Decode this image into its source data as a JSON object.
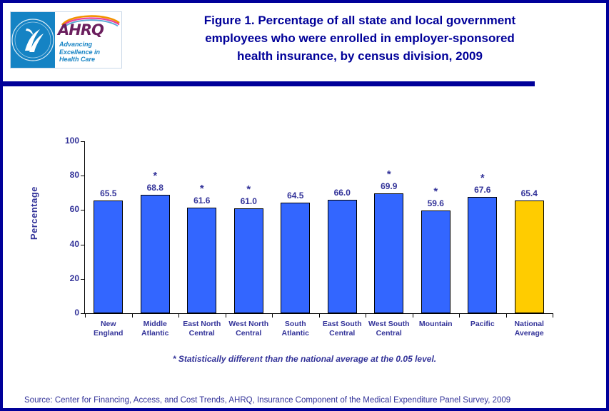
{
  "header": {
    "title": "Figure 1. Percentage of all state and local government employees who were enrolled in employer-sponsored health insurance, by census division, 2009",
    "title_line1": "Figure 1. Percentage of all state and local government",
    "title_line2": "employees who were enrolled in employer-sponsored",
    "title_line3": "health insurance, by census division, 2009",
    "logo": {
      "agency_acronym": "AHRQ",
      "tagline_line1": "Advancing",
      "tagline_line2": "Excellence in",
      "tagline_line3": "Health Care",
      "seal_name": "hhs-seal-icon"
    }
  },
  "footnote": "* Statistically different than the national average at the 0.05 level.",
  "source": "Source: Center for Financing, Access, and Cost Trends, AHRQ, Insurance Component of the Medical Expenditure Panel Survey, 2009",
  "colors": {
    "border": "#000099",
    "title_text": "#000099",
    "chart_text": "#333399",
    "bar_blue": "#3366FF",
    "bar_gold": "#FFCC00",
    "bar_outline": "#000000"
  },
  "chart_data": {
    "type": "bar",
    "title": "Figure 1. Percentage of all state and local government employees who were enrolled in employer-sponsored health insurance, by census division, 2009",
    "xlabel": "",
    "ylabel": "Percentage",
    "ylim": [
      0,
      100
    ],
    "yticks": [
      0,
      20,
      40,
      60,
      80,
      100
    ],
    "ytick_labels": [
      "0",
      "20",
      "40",
      "60",
      "80",
      "100"
    ],
    "grid": false,
    "legend": null,
    "categories": [
      "New England",
      "Middle Atlantic",
      "East North Central",
      "West North Central",
      "South Atlantic",
      "East South Central",
      "West South Central",
      "Mountain",
      "Pacific",
      "National Average"
    ],
    "category_lines": [
      [
        "New",
        "England"
      ],
      [
        "Middle",
        "Atlantic"
      ],
      [
        "East North",
        "Central"
      ],
      [
        "West North",
        "Central"
      ],
      [
        "South",
        "Atlantic"
      ],
      [
        "East South",
        "Central"
      ],
      [
        "West South",
        "Central"
      ],
      [
        "Mountain",
        ""
      ],
      [
        "Pacific",
        ""
      ],
      [
        "National",
        "Average"
      ]
    ],
    "values": [
      65.5,
      68.8,
      61.6,
      61.0,
      64.5,
      66.0,
      69.9,
      59.6,
      67.6,
      65.4
    ],
    "value_labels": [
      "65.5",
      "68.8",
      "61.6",
      "61.0",
      "64.5",
      "66.0",
      "69.9",
      "59.6",
      "67.6",
      "65.4"
    ],
    "significance_marked": [
      false,
      true,
      true,
      true,
      false,
      false,
      true,
      true,
      true,
      false
    ],
    "significance_symbol": "*",
    "bar_colors": [
      "#3366FF",
      "#3366FF",
      "#3366FF",
      "#3366FF",
      "#3366FF",
      "#3366FF",
      "#3366FF",
      "#3366FF",
      "#3366FF",
      "#FFCC00"
    ],
    "annotation": "* Statistically different than the national average at the 0.05 level."
  }
}
